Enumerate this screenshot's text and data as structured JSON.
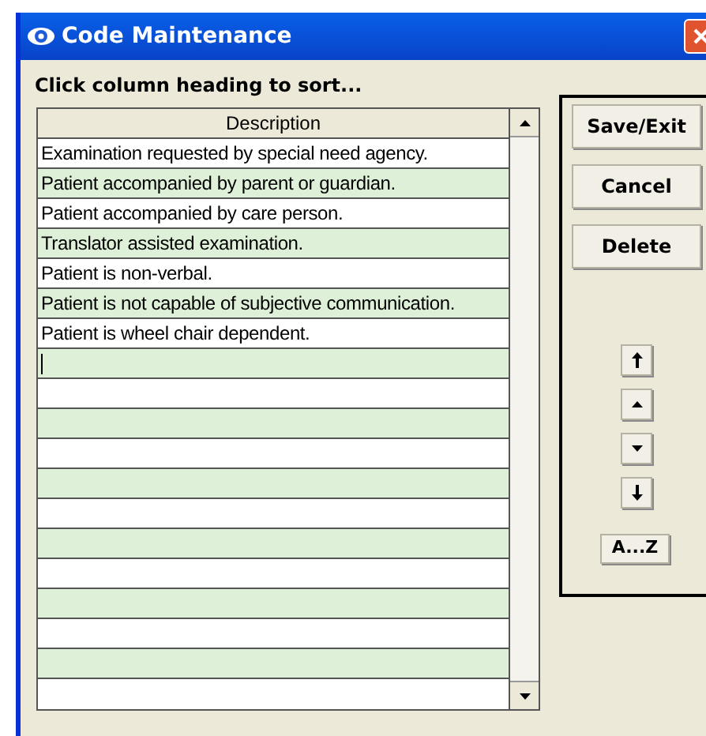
{
  "window": {
    "title": "Code Maintenance"
  },
  "instruction": "Click column heading to sort...",
  "table": {
    "columns": [
      "Description"
    ],
    "rows": [
      {
        "text": "Examination requested by special need agency.",
        "editing": false
      },
      {
        "text": "Patient accompanied by parent or guardian.",
        "editing": false
      },
      {
        "text": "Patient accompanied by care person.",
        "editing": false
      },
      {
        "text": "Translator assisted examination.",
        "editing": false
      },
      {
        "text": "Patient is non-verbal.",
        "editing": false
      },
      {
        "text": "Patient is not capable of subjective communication.",
        "editing": false
      },
      {
        "text": "Patient is wheel chair dependent.",
        "editing": false
      },
      {
        "editing": true
      }
    ]
  },
  "buttons": [
    "Save/Exit",
    "Cancel",
    "Delete"
  ],
  "order_buttons": [
    {
      "kind": "top"
    },
    {
      "kind": "up"
    },
    {
      "kind": "down"
    },
    {
      "kind": "bottom"
    }
  ],
  "sort_button": "A...Z"
}
